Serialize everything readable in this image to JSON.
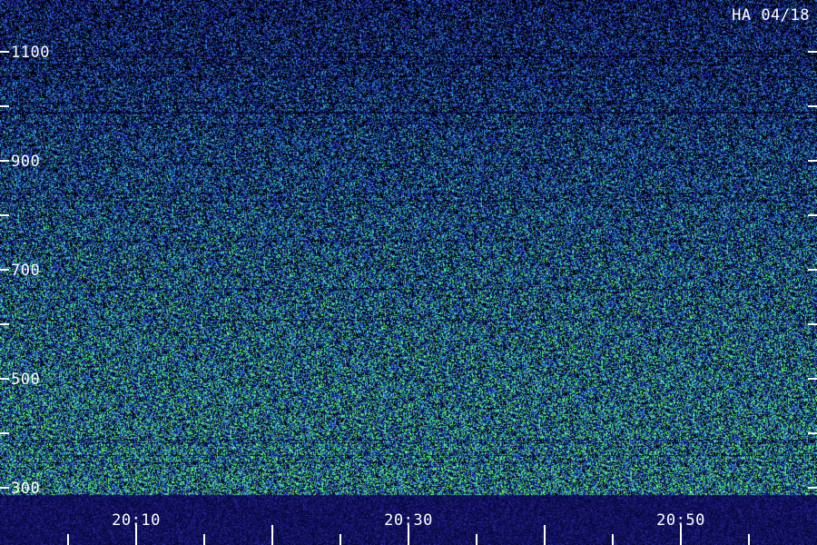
{
  "chart_data": {
    "type": "heatmap",
    "title": "HA 04/18",
    "xlabel": "",
    "ylabel": "",
    "x_tick_labels": [
      "20:10",
      "20:30",
      "20:50"
    ],
    "y_tick_labels": [
      "300",
      "500",
      "700",
      "900",
      "1100"
    ],
    "x_range": [
      "20:00",
      "20:59"
    ],
    "y_range": [
      300,
      1180
    ],
    "y_minor_step": 100,
    "x_minor_step_minutes": 5,
    "colormap": [
      "#000000",
      "#1a1a9e",
      "#2850d0",
      "#2aa0e0",
      "#40e0a0",
      "#60ff60"
    ],
    "notes_intensity": "stronger signal toward low frequencies (300-600), weak noise-like background above"
  }
}
